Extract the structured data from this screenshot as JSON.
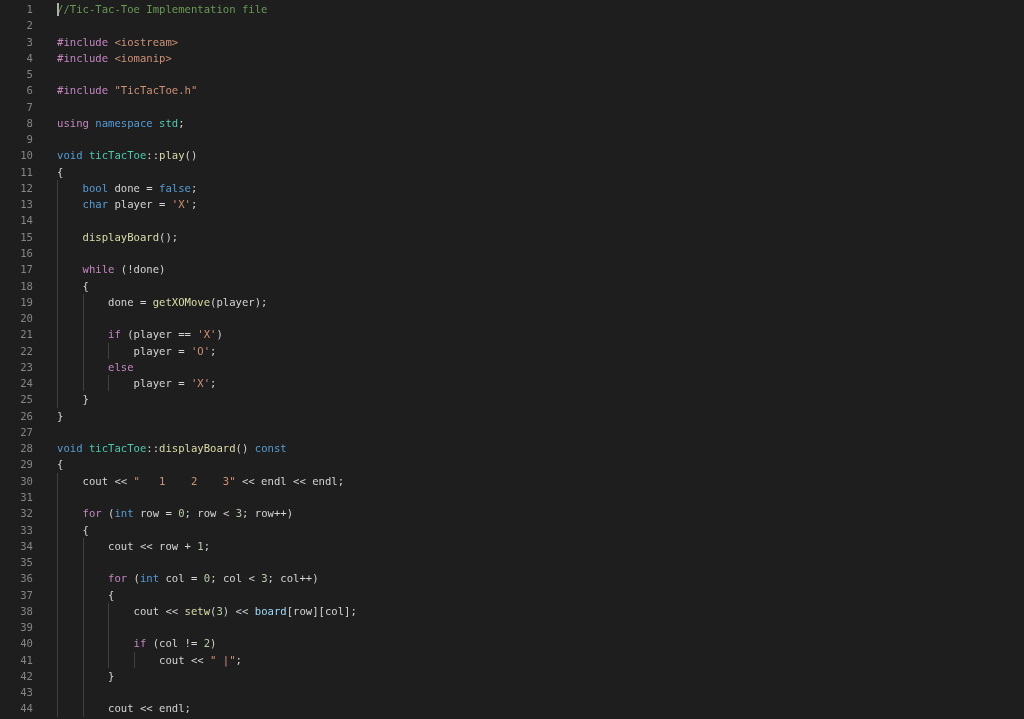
{
  "editor": {
    "lines": [
      {
        "number": "1",
        "cursor": true,
        "tokens": [
          {
            "text": "//Tic-Tac-Toe Implementation file",
            "kind": "comment"
          }
        ]
      },
      {
        "number": "2",
        "cursor": false
      },
      {
        "number": "3",
        "cursor": false,
        "tokens": [
          {
            "text": "#include ",
            "kind": "keyword"
          },
          {
            "text": "<iostream>",
            "kind": "string"
          }
        ]
      },
      {
        "number": "4",
        "cursor": false,
        "tokens": [
          {
            "text": "#include ",
            "kind": "keyword"
          },
          {
            "text": "<iomanip>",
            "kind": "string"
          }
        ]
      },
      {
        "number": "5",
        "cursor": false
      },
      {
        "number": "6",
        "cursor": false,
        "tokens": [
          {
            "text": "#include ",
            "kind": "keyword"
          },
          {
            "text": "\"TicTacToe.h\"",
            "kind": "string"
          }
        ]
      },
      {
        "number": "7",
        "cursor": false
      },
      {
        "number": "8",
        "cursor": false,
        "tokens": [
          {
            "text": "using ",
            "kind": "keyword"
          },
          {
            "text": "namespace ",
            "kind": "type"
          },
          {
            "text": "std",
            "kind": "class"
          },
          {
            "text": ";",
            "kind": "plain"
          }
        ]
      },
      {
        "number": "9",
        "cursor": false
      },
      {
        "number": "10",
        "cursor": false,
        "tokens": [
          {
            "text": "void ",
            "kind": "type"
          },
          {
            "text": "ticTacToe",
            "kind": "class"
          },
          {
            "text": "::",
            "kind": "plain"
          },
          {
            "text": "play",
            "kind": "function"
          },
          {
            "text": "()",
            "kind": "plain"
          }
        ]
      },
      {
        "number": "11",
        "cursor": false,
        "tokens": [
          {
            "text": "{",
            "kind": "plain"
          }
        ]
      },
      {
        "number": "12",
        "cursor": false,
        "tokens": [
          {
            "text": "    bool",
            "kind": "type"
          },
          {
            "text": " done = ",
            "kind": "plain"
          },
          {
            "text": "false",
            "kind": "type"
          },
          {
            "text": ";",
            "kind": "plain"
          }
        ]
      },
      {
        "number": "13",
        "cursor": false,
        "tokens": [
          {
            "text": "    char",
            "kind": "type"
          },
          {
            "text": " player = ",
            "kind": "plain"
          },
          {
            "text": "'X'",
            "kind": "string"
          },
          {
            "text": ";",
            "kind": "plain"
          }
        ]
      },
      {
        "number": "14",
        "cursor": false
      },
      {
        "number": "15",
        "cursor": false,
        "tokens": [
          {
            "text": "    displayBoard",
            "kind": "function"
          },
          {
            "text": "();",
            "kind": "plain"
          }
        ]
      },
      {
        "number": "16",
        "cursor": false
      },
      {
        "number": "17",
        "cursor": false,
        "tokens": [
          {
            "text": "    while",
            "kind": "keyword"
          },
          {
            "text": " (!done)",
            "kind": "plain"
          }
        ]
      },
      {
        "number": "18",
        "cursor": false,
        "tokens": [
          {
            "text": "    {",
            "kind": "plain"
          }
        ]
      },
      {
        "number": "19",
        "cursor": false,
        "tokens": [
          {
            "text": "        done = ",
            "kind": "plain"
          },
          {
            "text": "getXOMove",
            "kind": "function"
          },
          {
            "text": "(player);",
            "kind": "plain"
          }
        ]
      },
      {
        "number": "20",
        "cursor": false
      },
      {
        "number": "21",
        "cursor": false,
        "tokens": [
          {
            "text": "        if",
            "kind": "keyword"
          },
          {
            "text": " (player == ",
            "kind": "plain"
          },
          {
            "text": "'X'",
            "kind": "string"
          },
          {
            "text": ")",
            "kind": "plain"
          }
        ]
      },
      {
        "number": "22",
        "cursor": false,
        "tokens": [
          {
            "text": "            player = ",
            "kind": "plain"
          },
          {
            "text": "'O'",
            "kind": "string"
          },
          {
            "text": ";",
            "kind": "plain"
          }
        ]
      },
      {
        "number": "23",
        "cursor": false,
        "tokens": [
          {
            "text": "        else",
            "kind": "keyword"
          }
        ]
      },
      {
        "number": "24",
        "cursor": false,
        "tokens": [
          {
            "text": "            player = ",
            "kind": "plain"
          },
          {
            "text": "'X'",
            "kind": "string"
          },
          {
            "text": ";",
            "kind": "plain"
          }
        ]
      },
      {
        "number": "25",
        "cursor": false,
        "tokens": [
          {
            "text": "    }",
            "kind": "plain"
          }
        ]
      },
      {
        "number": "26",
        "cursor": false,
        "tokens": [
          {
            "text": "}",
            "kind": "plain"
          }
        ]
      },
      {
        "number": "27",
        "cursor": false
      },
      {
        "number": "28",
        "cursor": false,
        "tokens": [
          {
            "text": "void ",
            "kind": "type"
          },
          {
            "text": "ticTacToe",
            "kind": "class"
          },
          {
            "text": "::",
            "kind": "plain"
          },
          {
            "text": "displayBoard",
            "kind": "function"
          },
          {
            "text": "() ",
            "kind": "plain"
          },
          {
            "text": "const",
            "kind": "type"
          }
        ]
      },
      {
        "number": "29",
        "cursor": false,
        "tokens": [
          {
            "text": "{",
            "kind": "plain"
          }
        ]
      },
      {
        "number": "30",
        "cursor": false,
        "tokens": [
          {
            "text": "    cout << ",
            "kind": "plain"
          },
          {
            "text": "\"   1    2    3\"",
            "kind": "string"
          },
          {
            "text": " << endl << endl;",
            "kind": "plain"
          }
        ]
      },
      {
        "number": "31",
        "cursor": false
      },
      {
        "number": "32",
        "cursor": false,
        "tokens": [
          {
            "text": "    for",
            "kind": "keyword"
          },
          {
            "text": " (",
            "kind": "plain"
          },
          {
            "text": "int",
            "kind": "type"
          },
          {
            "text": " row = ",
            "kind": "plain"
          },
          {
            "text": "0",
            "kind": "number"
          },
          {
            "text": "; row < ",
            "kind": "plain"
          },
          {
            "text": "3",
            "kind": "number"
          },
          {
            "text": "; row++)",
            "kind": "plain"
          }
        ]
      },
      {
        "number": "33",
        "cursor": false,
        "tokens": [
          {
            "text": "    {",
            "kind": "plain"
          }
        ]
      },
      {
        "number": "34",
        "cursor": false,
        "tokens": [
          {
            "text": "        cout << row + ",
            "kind": "plain"
          },
          {
            "text": "1",
            "kind": "number"
          },
          {
            "text": ";",
            "kind": "plain"
          }
        ]
      },
      {
        "number": "35",
        "cursor": false
      },
      {
        "number": "36",
        "cursor": false,
        "tokens": [
          {
            "text": "        for",
            "kind": "keyword"
          },
          {
            "text": " (",
            "kind": "plain"
          },
          {
            "text": "int",
            "kind": "type"
          },
          {
            "text": " col = ",
            "kind": "plain"
          },
          {
            "text": "0",
            "kind": "number"
          },
          {
            "text": "; col < ",
            "kind": "plain"
          },
          {
            "text": "3",
            "kind": "number"
          },
          {
            "text": "; col++)",
            "kind": "plain"
          }
        ]
      },
      {
        "number": "37",
        "cursor": false,
        "tokens": [
          {
            "text": "        {",
            "kind": "plain"
          }
        ]
      },
      {
        "number": "38",
        "cursor": false,
        "tokens": [
          {
            "text": "            cout << ",
            "kind": "plain"
          },
          {
            "text": "setw",
            "kind": "function"
          },
          {
            "text": "(",
            "kind": "plain"
          },
          {
            "text": "3",
            "kind": "number"
          },
          {
            "text": ") << ",
            "kind": "plain"
          },
          {
            "text": "board",
            "kind": "variable"
          },
          {
            "text": "[row][col];",
            "kind": "plain"
          }
        ]
      },
      {
        "number": "39",
        "cursor": false
      },
      {
        "number": "40",
        "cursor": false,
        "tokens": [
          {
            "text": "            if",
            "kind": "keyword"
          },
          {
            "text": " (col != ",
            "kind": "plain"
          },
          {
            "text": "2",
            "kind": "number"
          },
          {
            "text": ")",
            "kind": "plain"
          }
        ]
      },
      {
        "number": "41",
        "cursor": false,
        "tokens": [
          {
            "text": "                cout << ",
            "kind": "plain"
          },
          {
            "text": "\" |\"",
            "kind": "string"
          },
          {
            "text": ";",
            "kind": "plain"
          }
        ]
      },
      {
        "number": "42",
        "cursor": false,
        "tokens": [
          {
            "text": "        }",
            "kind": "plain"
          }
        ]
      },
      {
        "number": "43",
        "cursor": false
      },
      {
        "number": "44",
        "cursor": false,
        "tokens": [
          {
            "text": "        cout << endl;",
            "kind": "plain"
          }
        ]
      }
    ]
  }
}
